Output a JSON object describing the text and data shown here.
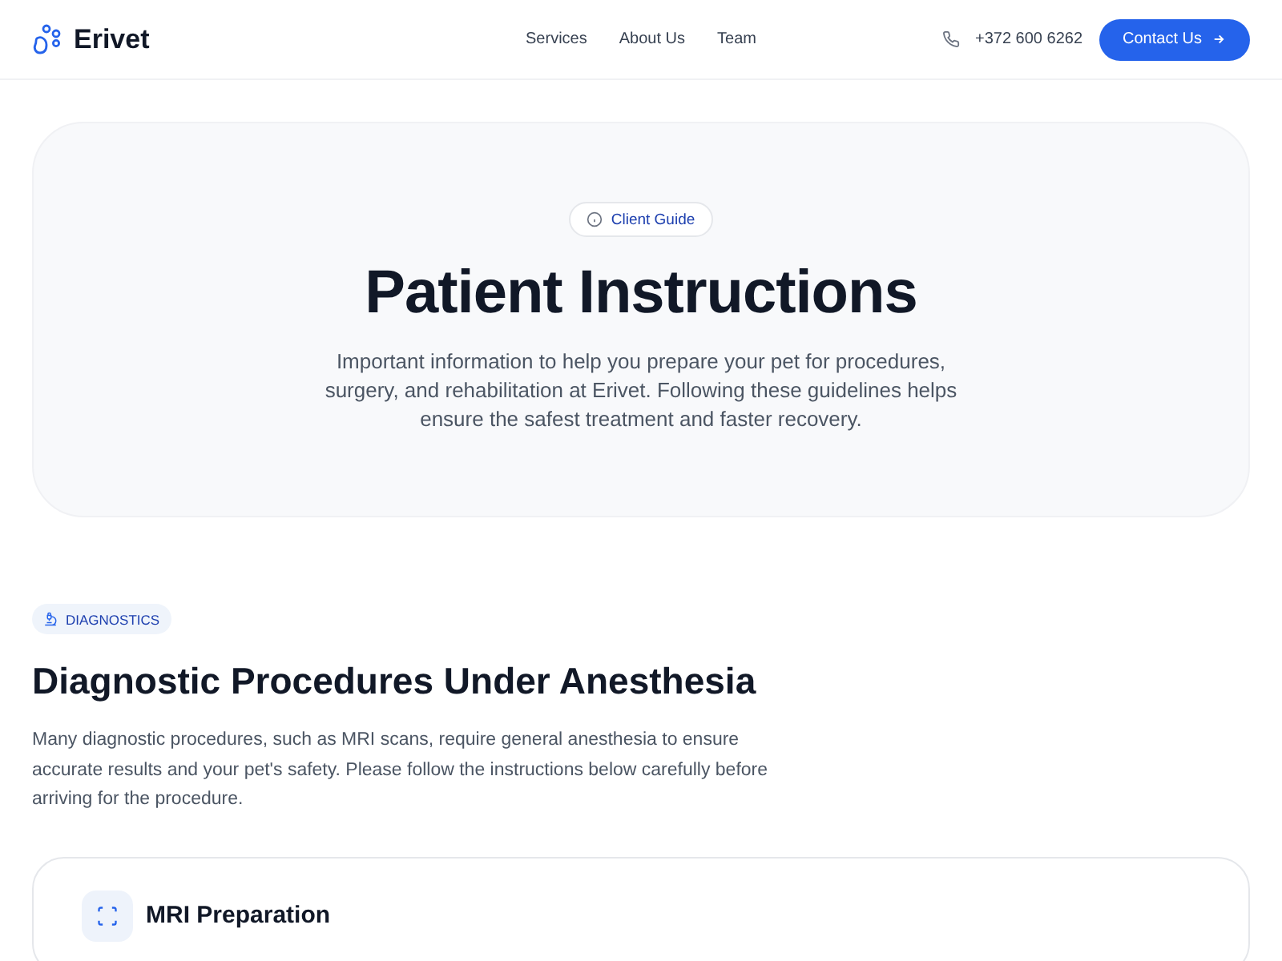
{
  "header": {
    "logo": "Erivet",
    "nav": [
      "Services",
      "About Us",
      "Team"
    ],
    "phone": "+372 600 6262",
    "cta": "Contact Us"
  },
  "hero": {
    "badge": "Client Guide",
    "title": "Patient Instructions",
    "text": "Important information to help you prepare your pet for procedures, surgery, and rehabilitation at Erivet. Following these guidelines helps ensure the safest treatment and faster recovery."
  },
  "section": {
    "badge": "DIAGNOSTICS",
    "title": "Diagnostic Procedures Under Anesthesia",
    "text": "Many diagnostic procedures, such as MRI scans, require general anesthesia to ensure accurate results and your pet's safety. Please follow the instructions below carefully before arriving for the procedure.",
    "card_title": "MRI Preparation"
  }
}
